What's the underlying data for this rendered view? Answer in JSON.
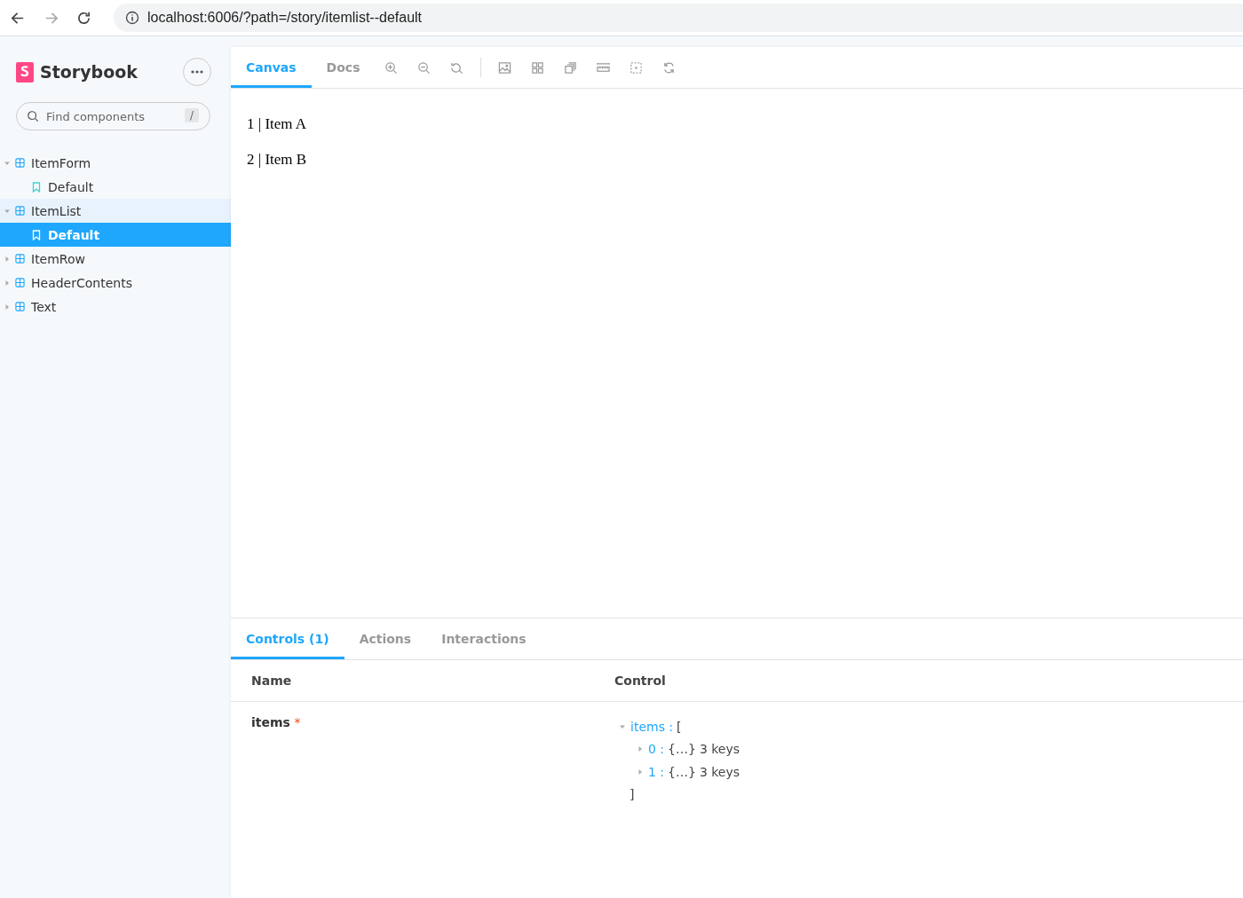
{
  "browser": {
    "url": "localhost:6006/?path=/story/itemlist--default"
  },
  "sidebar": {
    "brand": "Storybook",
    "search": {
      "placeholder": "Find components",
      "shortcut": "/"
    },
    "tree": [
      {
        "label": "ItemForm",
        "kind": "component",
        "expanded": true,
        "children": [
          {
            "label": "Default",
            "kind": "story",
            "selected": false
          }
        ]
      },
      {
        "label": "ItemList",
        "kind": "component",
        "expanded": true,
        "children": [
          {
            "label": "Default",
            "kind": "story",
            "selected": true
          }
        ]
      },
      {
        "label": "ItemRow",
        "kind": "component",
        "expanded": false
      },
      {
        "label": "HeaderContents",
        "kind": "component",
        "expanded": false
      },
      {
        "label": "Text",
        "kind": "component",
        "expanded": false
      }
    ]
  },
  "tabs": [
    {
      "label": "Canvas",
      "selected": true
    },
    {
      "label": "Docs",
      "selected": false
    }
  ],
  "canvas": {
    "lines": [
      "1 | Item A",
      "2 | Item B"
    ]
  },
  "addon_tabs": [
    {
      "label": "Controls (1)",
      "selected": true
    },
    {
      "label": "Actions",
      "selected": false
    },
    {
      "label": "Interactions",
      "selected": false
    }
  ],
  "controls": {
    "columns": [
      "Name",
      "Control"
    ],
    "rows": [
      {
        "name": "items",
        "required": true,
        "required_mark": "*",
        "key": "items :",
        "expanded": true,
        "open": "[",
        "close": "]",
        "entries": [
          {
            "key": "0 :",
            "value": "{…}",
            "count": "3 keys",
            "expanded": false
          },
          {
            "key": "1 :",
            "value": "{…}",
            "count": "3 keys",
            "expanded": false
          }
        ]
      }
    ]
  }
}
